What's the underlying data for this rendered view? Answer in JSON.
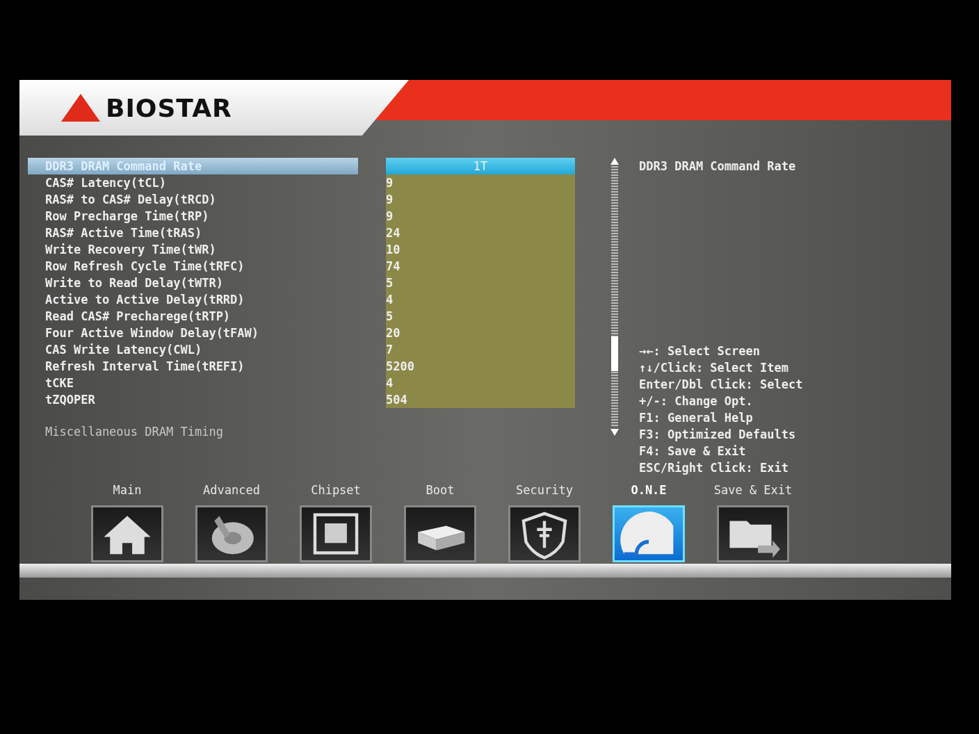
{
  "header": {
    "brand": "BIOSTAR"
  },
  "settings": [
    {
      "label": "DDR3 DRAM Command Rate",
      "value": "1T",
      "selected": true
    },
    {
      "label": "CAS# Latency(tCL)",
      "value": "9",
      "selected": false
    },
    {
      "label": "RAS# to CAS# Delay(tRCD)",
      "value": "9",
      "selected": false
    },
    {
      "label": "Row Precharge Time(tRP)",
      "value": "9",
      "selected": false
    },
    {
      "label": "RAS# Active Time(tRAS)",
      "value": "24",
      "selected": false
    },
    {
      "label": "Write Recovery Time(tWR)",
      "value": "10",
      "selected": false
    },
    {
      "label": "Row Refresh Cycle Time(tRFC)",
      "value": "74",
      "selected": false
    },
    {
      "label": "Write to Read Delay(tWTR)",
      "value": "5",
      "selected": false
    },
    {
      "label": "Active to Active Delay(tRRD)",
      "value": "4",
      "selected": false
    },
    {
      "label": "Read CAS# Precharege(tRTP)",
      "value": "5",
      "selected": false
    },
    {
      "label": "Four Active Window Delay(tFAW)",
      "value": "20",
      "selected": false
    },
    {
      "label": "CAS Write Latency(CWL)",
      "value": "7",
      "selected": false
    },
    {
      "label": "Refresh Interval Time(tREFI)",
      "value": "5200",
      "selected": false
    },
    {
      "label": "tCKE",
      "value": "4",
      "selected": false
    },
    {
      "label": "tZQOPER",
      "value": "504",
      "selected": false
    }
  ],
  "submenus": [
    {
      "label": "Miscellaneous DRAM Timing",
      "disabled": true
    }
  ],
  "help": {
    "title": "DDR3 DRAM Command Rate",
    "keys": [
      "→←: Select Screen",
      "↑↓/Click: Select Item",
      "Enter/Dbl Click: Select",
      "+/-: Change Opt.",
      "F1: General Help",
      "F3: Optimized Defaults",
      "F4: Save & Exit",
      "ESC/Right Click: Exit"
    ]
  },
  "tabs": [
    {
      "label": "Main",
      "kind": "home",
      "selected": false
    },
    {
      "label": "Advanced",
      "kind": "switch",
      "selected": false
    },
    {
      "label": "Chipset",
      "kind": "chip",
      "selected": false
    },
    {
      "label": "Boot",
      "kind": "drive",
      "selected": false
    },
    {
      "label": "Security",
      "kind": "shield",
      "selected": false
    },
    {
      "label": "O.N.E",
      "kind": "gauge",
      "selected": true
    },
    {
      "label": "Save & Exit",
      "kind": "folder",
      "selected": false
    }
  ]
}
